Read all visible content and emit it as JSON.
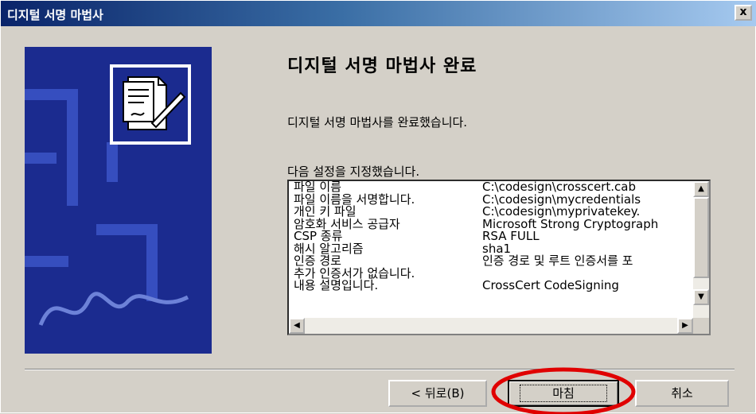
{
  "window": {
    "title": "디지털 서명 마법사",
    "close_label": "x"
  },
  "main": {
    "heading": "디지털 서명 마법사 완료",
    "completed_message": "디지털 서명 마법사를 완료했습니다.",
    "settings_label": "다음 설정을 지정했습니다."
  },
  "settings": [
    {
      "key": "파일 이름",
      "value": "C:\\codesign\\crosscert.cab"
    },
    {
      "key": "파일 이름을 서명합니다.",
      "value": "C:\\codesign\\mycredentials"
    },
    {
      "key": "개인 키 파일",
      "value": "C:\\codesign\\myprivatekey."
    },
    {
      "key": "암호화 서비스 공급자",
      "value": "Microsoft Strong Cryptograph"
    },
    {
      "key": "CSP 종류",
      "value": "RSA FULL"
    },
    {
      "key": "해시 알고리즘",
      "value": "sha1"
    },
    {
      "key": "인증 경로",
      "value": "인증 경로 및 루트 인증서를 포"
    },
    {
      "key": "추가 인증서가 없습니다.",
      "value": ""
    },
    {
      "key": "내용 설명입니다.",
      "value": "CrossCert CodeSigning"
    }
  ],
  "buttons": {
    "back": "< 뒤로(B)",
    "finish": "마침",
    "cancel": "취소"
  },
  "colors": {
    "annotation_circle": "#e00000",
    "banner_background": "#1b2b8f"
  },
  "icons": {
    "banner": "document-sign-icon"
  }
}
